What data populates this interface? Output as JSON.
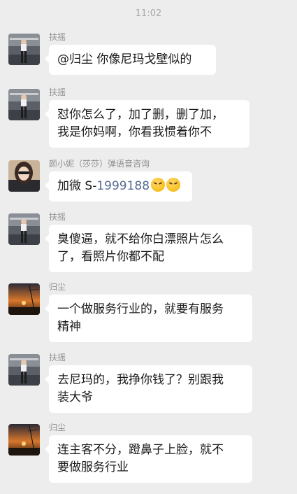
{
  "status": {
    "time": "11:02"
  },
  "messages": [
    {
      "sender": "扶摇",
      "avatar_icon": "woman-photo-avatar-icon",
      "lines": [
        "@归尘 你像尼玛戈壁似的"
      ]
    },
    {
      "sender": "扶摇",
      "avatar_icon": "woman-photo-avatar-icon",
      "lines": [
        "怼你怎么了，加了删，删了加，",
        "我是你妈啊，你看我惯着你不"
      ]
    },
    {
      "sender": "颜小妮（莎莎）弹语音咨询",
      "avatar_icon": "selfie-avatar-icon",
      "text_prefix": "加微 S-",
      "text_number": "1999188",
      "emoji_icon": "angry-face-emoji-icon"
    },
    {
      "sender": "扶摇",
      "avatar_icon": "woman-photo-avatar-icon",
      "lines": [
        "臭傻逼，就不给你白漂照片怎么",
        "了，看照片你都不配"
      ]
    },
    {
      "sender": "归尘",
      "avatar_icon": "sunset-avatar-icon",
      "lines": [
        "一个做服务行业的，就要有服务",
        "精神"
      ]
    },
    {
      "sender": "扶摇",
      "avatar_icon": "woman-photo-avatar-icon",
      "lines": [
        "去尼玛的，我挣你钱了？别跟我",
        "装大爷"
      ]
    },
    {
      "sender": "归尘",
      "avatar_icon": "sunset-avatar-icon",
      "lines": [
        "连主客不分，蹬鼻子上脸，就不",
        "要做服务行业"
      ]
    }
  ]
}
